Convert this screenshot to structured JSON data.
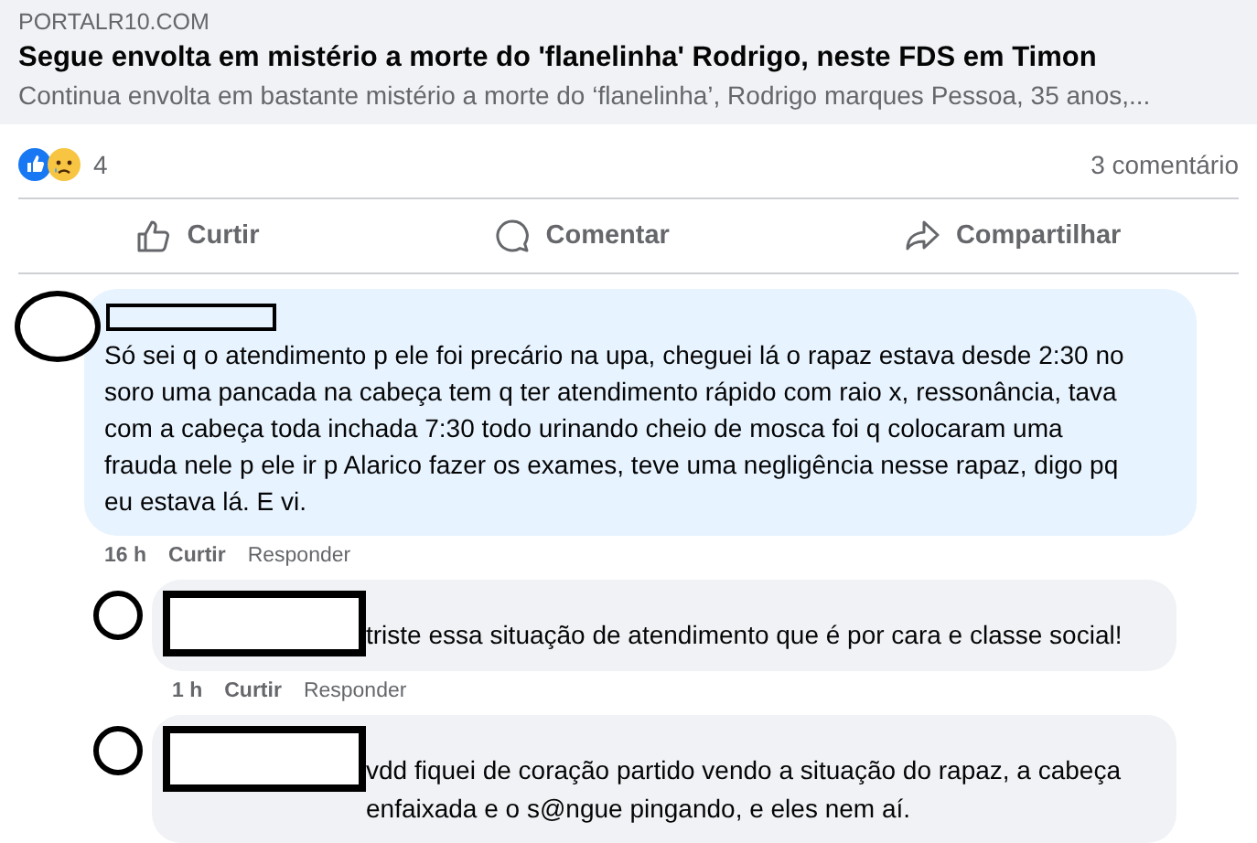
{
  "link_preview": {
    "source": "PORTALR10.COM",
    "title": "Segue envolta em mistério a morte do 'flanelinha' Rodrigo, neste FDS em Timon",
    "description": "Continua envolta em bastante mistério a morte do ‘flanelinha’, Rodrigo marques Pessoa, 35 anos,..."
  },
  "reactions": {
    "count": "4",
    "comments": "3 comentário"
  },
  "actions": [
    {
      "kind": "like",
      "label": "Curtir"
    },
    {
      "kind": "comment",
      "label": "Comentar"
    },
    {
      "kind": "share",
      "label": "Compartilhar"
    }
  ],
  "comments": [
    {
      "text": "Só sei q o atendimento p ele foi precário na upa, cheguei lá o rapaz estava desde 2:30 no soro uma pancada na cabeça tem q ter atendimento rápido com raio x, ressonância, tava com a cabeça toda inchada 7:30 todo urinando cheio de mosca foi q colocaram uma frauda nele p ele ir p Alarico fazer os exames, teve uma negligência nesse rapaz, digo pq eu estava lá. E vi.",
      "time": "16 h",
      "links": [
        "Curtir",
        "Responder"
      ],
      "replies": [
        {
          "text": "triste essa situação de atendimento que é por cara e classe social!",
          "time": "1 h",
          "links": [
            "Curtir",
            "Responder"
          ]
        },
        {
          "text": "vdd fiquei de coração partido vendo a situação do rapaz, a cabeça enfaixada e o s@ngue pingando, e eles nem aí."
        }
      ]
    }
  ]
}
